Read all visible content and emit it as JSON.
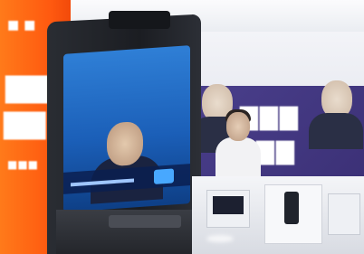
{
  "scene": {
    "description_free": true,
    "colors": {
      "banner": "#ff5a10",
      "poster": "#3a2f74",
      "screen": "#1b5fb8",
      "kiosk": "#1b1d22"
    }
  }
}
